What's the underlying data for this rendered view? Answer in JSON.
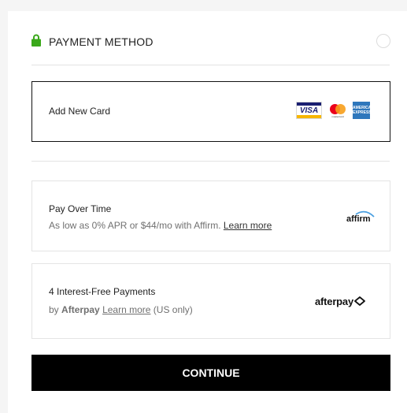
{
  "header": {
    "title": "PAYMENT METHOD"
  },
  "card_option": {
    "label": "Add New Card",
    "logos": {
      "visa": "VISA",
      "mastercard": "mastercard",
      "amex": "AMERICAN EXPRESS"
    }
  },
  "affirm": {
    "title": "Pay Over Time",
    "subtitle_prefix": "As low as 0% APR or $44/mo with Affirm.",
    "learn_more": "Learn more",
    "logo": "affirm"
  },
  "afterpay": {
    "title": "4 Interest-Free Payments",
    "by": "by",
    "brand": "Afterpay",
    "learn_more": "Learn more",
    "note": "(US only)",
    "logo": "afterpay"
  },
  "continue_label": "CONTINUE",
  "colors": {
    "lock": "#3aa81a",
    "button_bg": "#000000",
    "visa_blue": "#1a1f71",
    "visa_gold": "#f7b600",
    "mc_red": "#eb001b",
    "mc_orange": "#f79e1b",
    "amex_blue": "#2e77bc",
    "affirm_arc": "#4a9fe0"
  }
}
